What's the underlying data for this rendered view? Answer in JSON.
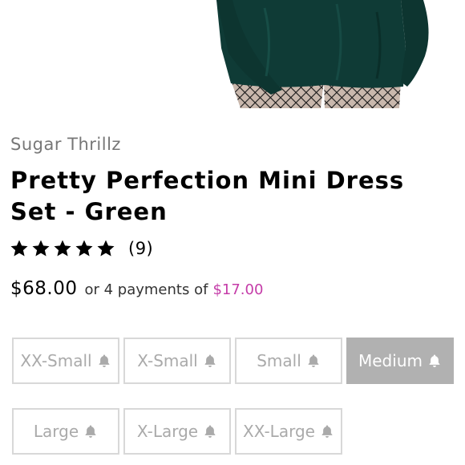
{
  "product": {
    "brand": "Sugar Thrillz",
    "title": "Pretty Perfection Mini Dress Set - Green",
    "rating_stars": 5,
    "rating_count": "(9)",
    "price": "$68.00",
    "installment_text": "or 4 payments of",
    "installment_amount": "$17.00"
  },
  "sizes": [
    {
      "label": "XX-Small",
      "icon": "bell-icon",
      "selected": false
    },
    {
      "label": "X-Small",
      "icon": "bell-icon",
      "selected": false
    },
    {
      "label": "Small",
      "icon": "bell-icon",
      "selected": false
    },
    {
      "label": "Medium",
      "icon": "bell-icon",
      "selected": true
    },
    {
      "label": "Large",
      "icon": "bell-icon",
      "selected": false
    },
    {
      "label": "X-Large",
      "icon": "bell-icon",
      "selected": false
    },
    {
      "label": "XX-Large",
      "icon": "bell-icon",
      "selected": false
    }
  ],
  "colors": {
    "dress": "#0f3b36",
    "price_accent": "#c43ca8",
    "selected_size_bg": "#b1b1b1",
    "size_border": "#d8d8d8"
  }
}
